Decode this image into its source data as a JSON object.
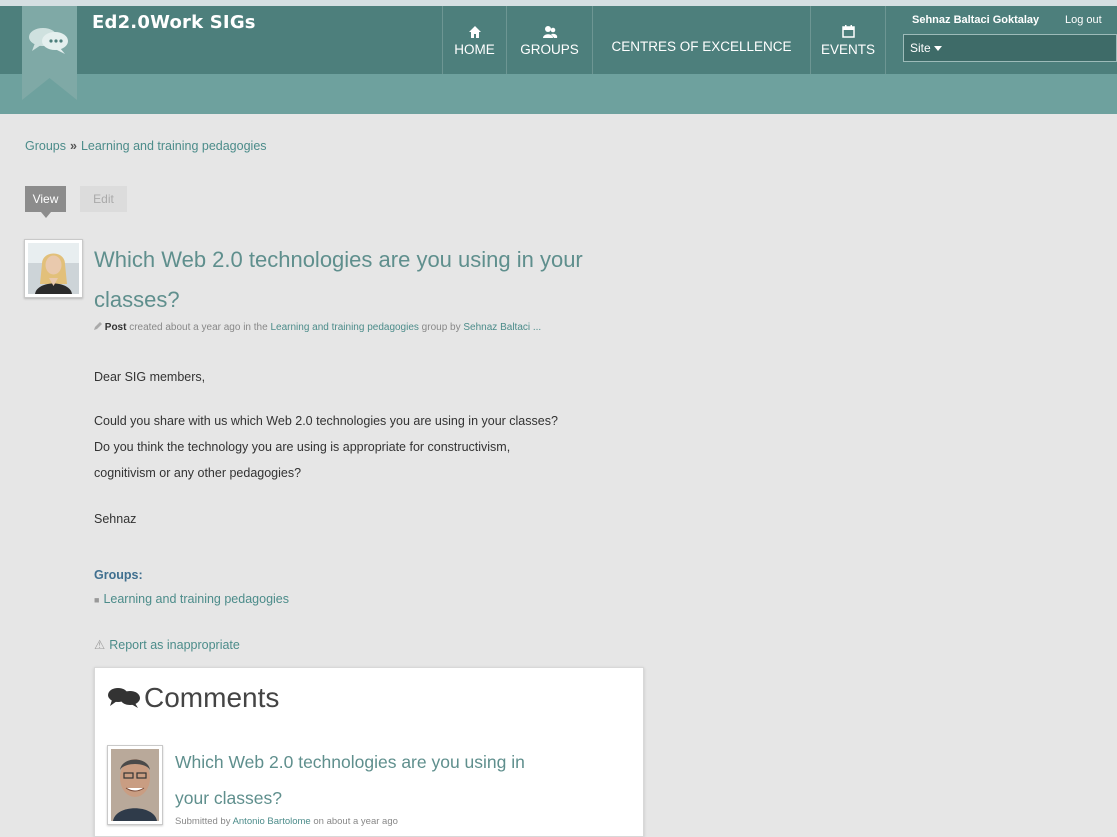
{
  "site": {
    "title": "Ed2.0Work SIGs"
  },
  "nav": {
    "home": "HOME",
    "groups": "GROUPS",
    "centres": "CENTRES OF EXCELLENCE",
    "events": "EVENTS"
  },
  "user": {
    "name": "Sehnaz Baltaci Goktalay",
    "logout": "Log out",
    "site_select": "Site"
  },
  "breadcrumb": {
    "root": "Groups",
    "separator": "»",
    "current": "Learning and training pedagogies"
  },
  "tabs": {
    "view": "View",
    "edit": "Edit"
  },
  "post": {
    "title": "Which Web 2.0 technologies are you using in your classes?",
    "meta_type": "Post",
    "meta_created": " created about a year ago in the ",
    "meta_group": "Learning and training pedagogies",
    "meta_by": " group by ",
    "meta_author": "Sehnaz Baltaci ...",
    "greeting": "Dear SIG members,",
    "para_line1": "Could you share with us which Web 2.0 technologies you are using in your classes?",
    "para_line2": "Do you think the technology you are using is appropriate for constructivism,",
    "para_line3": "cognitivism or any other pedagogies?",
    "signoff": "Sehnaz"
  },
  "groups_section": {
    "label": "Groups:",
    "item": "Learning and training pedagogies"
  },
  "report": {
    "label": "Report as inappropriate"
  },
  "comments": {
    "heading": "Comments",
    "items": [
      {
        "title": "Which Web 2.0 technologies are you using in your classes?",
        "submitted_prefix": "Submitted by ",
        "author": "Antonio Bartolome",
        "submitted_suffix": " on about a year ago"
      }
    ]
  },
  "colors": {
    "header": "#4d7f7c",
    "subbar": "#6ea19e",
    "link": "#4c8c8a",
    "background": "#e6e6e6"
  }
}
